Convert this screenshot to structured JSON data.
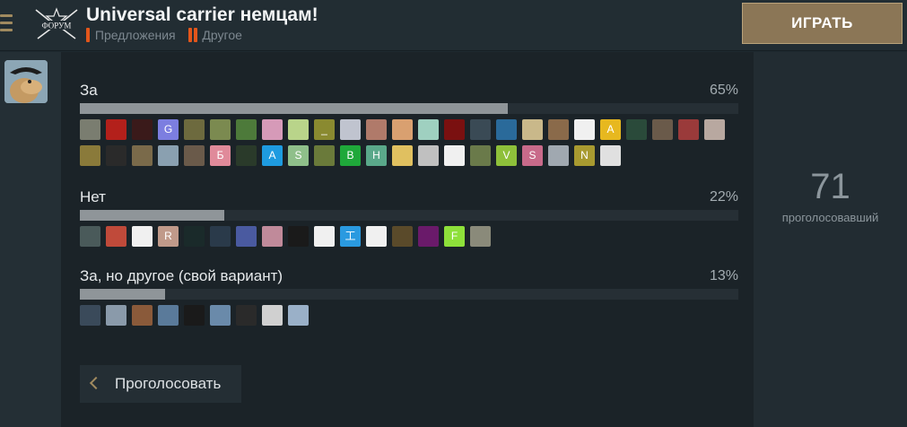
{
  "header": {
    "title": "Universal carrier немцам!",
    "logo_text": "ФОРУМ",
    "tags": [
      {
        "label": "Предложения",
        "marks": 1
      },
      {
        "label": "Другое",
        "marks": 2
      }
    ],
    "play_label": "ИГРАТЬ"
  },
  "poll": {
    "total_votes": "71",
    "total_label": "проголосовавший",
    "options": [
      {
        "label": "За",
        "percent": "65%",
        "fraction": 0.65,
        "voters": [
          {
            "text": "",
            "color": "#7a7d70"
          },
          {
            "text": "",
            "color": "#b3201b"
          },
          {
            "text": "",
            "color": "#3a1a1a"
          },
          {
            "text": "G",
            "color": "#7c7ee0"
          },
          {
            "text": "",
            "color": "#6d6a3e"
          },
          {
            "text": "",
            "color": "#7b8a50"
          },
          {
            "text": "",
            "color": "#4d7a3a"
          },
          {
            "text": "",
            "color": "#d69ab8"
          },
          {
            "text": "",
            "color": "#b9d48a"
          },
          {
            "text": "_",
            "color": "#8a8a30"
          },
          {
            "text": "",
            "color": "#c0c4cf"
          },
          {
            "text": "",
            "color": "#b07a6a"
          },
          {
            "text": "",
            "color": "#d9a070"
          },
          {
            "text": "",
            "color": "#9fd0c0"
          },
          {
            "text": "",
            "color": "#7a1010"
          },
          {
            "text": "",
            "color": "#3a4a55"
          },
          {
            "text": "",
            "color": "#2a6a9a"
          },
          {
            "text": "",
            "color": "#c9b88a"
          },
          {
            "text": "",
            "color": "#8a6a4a"
          },
          {
            "text": "",
            "color": "#f0f0f0"
          },
          {
            "text": "A",
            "color": "#e7b81f"
          },
          {
            "text": "",
            "color": "#2a4a3a"
          },
          {
            "text": "",
            "color": "#6a5a4a"
          },
          {
            "text": "",
            "color": "#9a3a3a"
          },
          {
            "text": "",
            "color": "#b8a8a0"
          },
          {
            "text": "",
            "color": "#8a7a3a"
          },
          {
            "text": "",
            "color": "#2a2a2a"
          },
          {
            "text": "",
            "color": "#7a6a4a"
          },
          {
            "text": "",
            "color": "#8aa0b0"
          },
          {
            "text": "",
            "color": "#6a5a4a"
          },
          {
            "text": "Б",
            "color": "#e08a9a"
          },
          {
            "text": "",
            "color": "#2a3a2a"
          },
          {
            "text": "A",
            "color": "#1e9be0"
          },
          {
            "text": "S",
            "color": "#8fbf8a"
          },
          {
            "text": "",
            "color": "#6a7a3a"
          },
          {
            "text": "B",
            "color": "#1fa83a"
          },
          {
            "text": "H",
            "color": "#5aa88a"
          },
          {
            "text": "",
            "color": "#e0c060"
          },
          {
            "text": "",
            "color": "#c0c0c0"
          },
          {
            "text": "",
            "color": "#f0f0f0"
          },
          {
            "text": "",
            "color": "#6a7a4a"
          },
          {
            "text": "V",
            "color": "#8ec03a"
          },
          {
            "text": "S",
            "color": "#c86a8a"
          },
          {
            "text": "",
            "color": "#a0a8b0"
          },
          {
            "text": "N",
            "color": "#a89a30"
          },
          {
            "text": "",
            "color": "#e0e0e0"
          }
        ]
      },
      {
        "label": "Нет",
        "percent": "22%",
        "fraction": 0.22,
        "voters": [
          {
            "text": "",
            "color": "#4a5a5a"
          },
          {
            "text": "",
            "color": "#c04a3a"
          },
          {
            "text": "",
            "color": "#f0f0f0"
          },
          {
            "text": "R",
            "color": "#c09a8a"
          },
          {
            "text": "",
            "color": "#1a2a2a"
          },
          {
            "text": "",
            "color": "#2a3a4a"
          },
          {
            "text": "",
            "color": "#4a5aa0"
          },
          {
            "text": "",
            "color": "#c08a9a"
          },
          {
            "text": "",
            "color": "#1a1a1a"
          },
          {
            "text": "",
            "color": "#f0f0f0"
          },
          {
            "text": "工",
            "color": "#2a9ae0"
          },
          {
            "text": "",
            "color": "#f0f0f0"
          },
          {
            "text": "",
            "color": "#5a4a2a"
          },
          {
            "text": "",
            "color": "#6a1a6a"
          },
          {
            "text": "F",
            "color": "#8ee03a"
          },
          {
            "text": "",
            "color": "#8a8a7a"
          }
        ]
      },
      {
        "label": "За, но другое (свой вариант)",
        "percent": "13%",
        "fraction": 0.13,
        "voters": [
          {
            "text": "",
            "color": "#3a4a5a"
          },
          {
            "text": "",
            "color": "#8a9aaa"
          },
          {
            "text": "",
            "color": "#8a5a3a"
          },
          {
            "text": "",
            "color": "#5a7a9a"
          },
          {
            "text": "",
            "color": "#1a1a1a"
          },
          {
            "text": "",
            "color": "#6a8aaa"
          },
          {
            "text": "",
            "color": "#2a2a2a"
          },
          {
            "text": "",
            "color": "#d0d0d0"
          },
          {
            "text": "",
            "color": "#9ab0c8"
          }
        ]
      }
    ],
    "vote_label": "Проголосовать"
  }
}
